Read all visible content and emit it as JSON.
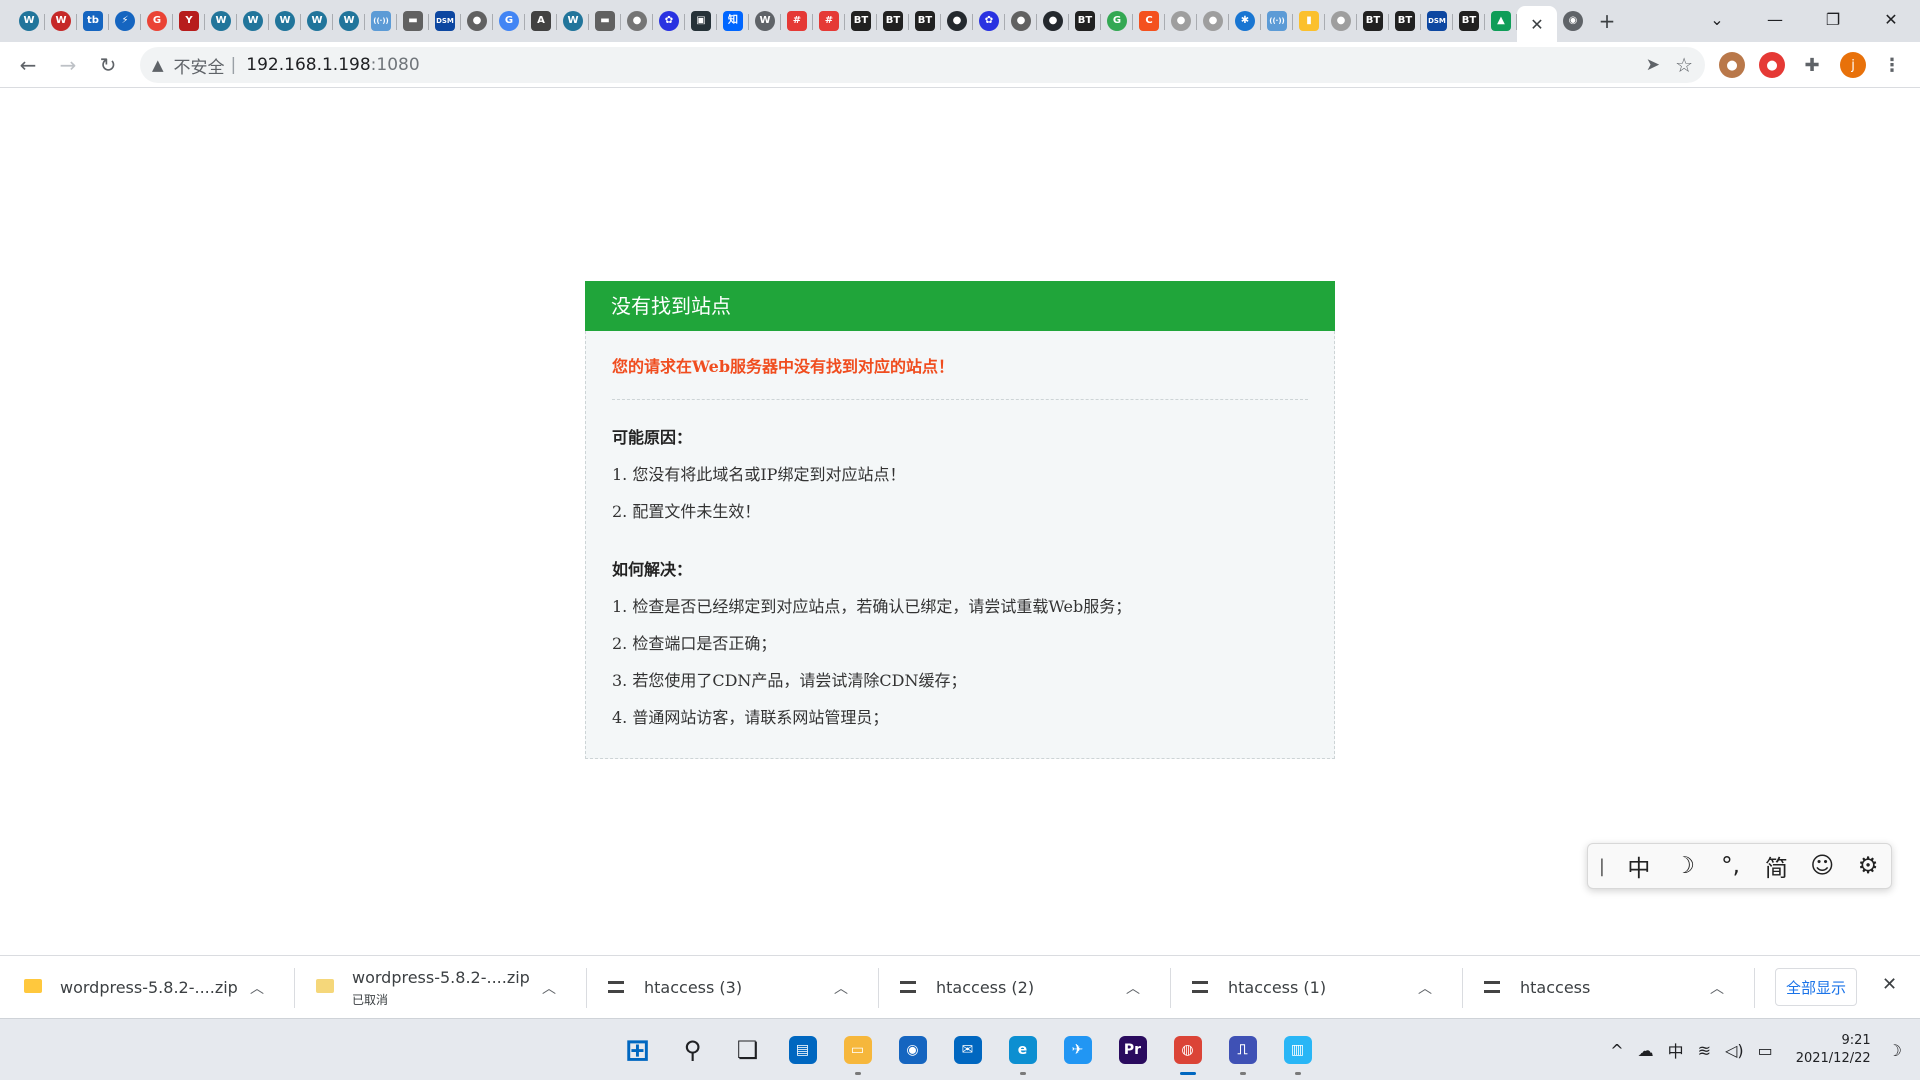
{
  "browser": {
    "tab_favicons": [
      {
        "icon": "wordpress-icon",
        "glyph": "W",
        "color": "#21759b",
        "round": true
      },
      {
        "icon": "wordpress-red-icon",
        "glyph": "W",
        "color": "#c62828",
        "round": true
      },
      {
        "icon": "tb-icon",
        "glyph": "tb",
        "color": "#1565c0",
        "round": false
      },
      {
        "icon": "lightning-icon",
        "glyph": "⚡",
        "color": "#1565c0",
        "round": true
      },
      {
        "icon": "google-icon",
        "glyph": "G",
        "color": "#ea4335",
        "round": true
      },
      {
        "icon": "bookmark-red-icon",
        "glyph": "Y",
        "color": "#b71c1c",
        "round": false
      },
      {
        "icon": "wordpress-icon",
        "glyph": "W",
        "color": "#21759b",
        "round": true
      },
      {
        "icon": "wordpress-icon",
        "glyph": "W",
        "color": "#21759b",
        "round": true
      },
      {
        "icon": "wordpress-icon",
        "glyph": "W",
        "color": "#21759b",
        "round": true
      },
      {
        "icon": "wordpress-icon",
        "glyph": "W",
        "color": "#21759b",
        "round": true
      },
      {
        "icon": "wordpress-icon",
        "glyph": "W",
        "color": "#21759b",
        "round": true
      },
      {
        "icon": "wireless-icon",
        "glyph": "((·))",
        "color": "#5c9bd6",
        "round": false
      },
      {
        "icon": "router-icon",
        "glyph": "▬",
        "color": "#616161",
        "round": false
      },
      {
        "icon": "dsm-icon",
        "glyph": "DSM",
        "color": "#0d47a1",
        "round": false
      },
      {
        "icon": "globe-icon",
        "glyph": "●",
        "color": "#616161",
        "round": true
      },
      {
        "icon": "google-icon",
        "glyph": "G",
        "color": "#4285f4",
        "round": true
      },
      {
        "icon": "finder-icon",
        "glyph": "A",
        "color": "#424242",
        "round": false
      },
      {
        "icon": "wordpress-icon",
        "glyph": "W",
        "color": "#21759b",
        "round": true
      },
      {
        "icon": "router-icon",
        "glyph": "▬",
        "color": "#616161",
        "round": false
      },
      {
        "icon": "globe-icon",
        "glyph": "●",
        "color": "#757575",
        "round": true
      },
      {
        "icon": "baidu-icon",
        "glyph": "✿",
        "color": "#2932e1",
        "round": true
      },
      {
        "icon": "image-icon",
        "glyph": "▣",
        "color": "#263238",
        "round": false
      },
      {
        "icon": "zhihu-icon",
        "glyph": "知",
        "color": "#0066ff",
        "round": false
      },
      {
        "icon": "wordpress-icon",
        "glyph": "W",
        "color": "#5f6368",
        "round": true
      },
      {
        "icon": "hash-red-icon",
        "glyph": "#",
        "color": "#e53935",
        "round": false
      },
      {
        "icon": "hash-red-icon",
        "glyph": "#",
        "color": "#e53935",
        "round": false
      },
      {
        "icon": "bt-icon",
        "glyph": "BT",
        "color": "#212121",
        "round": false
      },
      {
        "icon": "bt-icon",
        "glyph": "BT",
        "color": "#212121",
        "round": false
      },
      {
        "icon": "bt-icon",
        "glyph": "BT",
        "color": "#212121",
        "round": false
      },
      {
        "icon": "github-icon",
        "glyph": "●",
        "color": "#24292e",
        "round": true
      },
      {
        "icon": "baidu-icon",
        "glyph": "✿",
        "color": "#2932e1",
        "round": true
      },
      {
        "icon": "globe-icon",
        "glyph": "●",
        "color": "#616161",
        "round": true
      },
      {
        "icon": "github-icon",
        "glyph": "●",
        "color": "#24292e",
        "round": true
      },
      {
        "icon": "bt-icon",
        "glyph": "BT",
        "color": "#212121",
        "round": false
      },
      {
        "icon": "google-icon",
        "glyph": "G",
        "color": "#34a853",
        "round": true
      },
      {
        "icon": "c-red-icon",
        "glyph": "C",
        "color": "#f4511e",
        "round": false
      },
      {
        "icon": "globe-icon",
        "glyph": "●",
        "color": "#9e9e9e",
        "round": true
      },
      {
        "icon": "globe-icon",
        "glyph": "●",
        "color": "#9e9e9e",
        "round": true
      },
      {
        "icon": "gear-blue-icon",
        "glyph": "✱",
        "color": "#1976d2",
        "round": true
      },
      {
        "icon": "wireless-icon",
        "glyph": "((·))",
        "color": "#5c9bd6",
        "round": false
      },
      {
        "icon": "chart-icon",
        "glyph": "▮",
        "color": "#fbc02d",
        "round": false
      },
      {
        "icon": "globe-icon",
        "glyph": "●",
        "color": "#9e9e9e",
        "round": true
      },
      {
        "icon": "bt-icon",
        "glyph": "BT",
        "color": "#212121",
        "round": false
      },
      {
        "icon": "bt-icon",
        "glyph": "BT",
        "color": "#212121",
        "round": false
      },
      {
        "icon": "dsm-icon",
        "glyph": "DSM",
        "color": "#0d47a1",
        "round": false
      },
      {
        "icon": "bt-icon",
        "glyph": "BT",
        "color": "#212121",
        "round": false
      },
      {
        "icon": "drive-icon",
        "glyph": "▲",
        "color": "#0f9d58",
        "round": false
      }
    ],
    "active_tab_close": "✕",
    "tail_favicon": {
      "icon": "chrome-gray-icon",
      "glyph": "◉"
    },
    "new_tab": "+",
    "tab_search": "⌄",
    "window_controls": {
      "minimize": "—",
      "restore": "❐",
      "close": "✕"
    },
    "address": {
      "insecure_label": "不安全",
      "separator": "|",
      "host": "192.168.1.198",
      "port": ":1080"
    },
    "profile_initial": "j"
  },
  "page": {
    "title": "没有找到站点",
    "error_message": "您的请求在Web服务器中没有找到对应的站点！",
    "causes_heading": "可能原因：",
    "causes": [
      "1.  您没有将此域名或IP绑定到对应站点！",
      "2.  配置文件未生效！"
    ],
    "solutions_heading": "如何解决：",
    "solutions": [
      "1.  检查是否已经绑定到对应站点，若确认已绑定，请尝试重载Web服务；",
      "2.  检查端口是否正确；",
      "3.  若您使用了CDN产品，请尝试清除CDN缓存；",
      "4.  普通网站访客，请联系网站管理员；"
    ]
  },
  "ime_toolbar": {
    "grip": "|",
    "mode": "中",
    "moon": "☽",
    "punct": "°,",
    "script": "简",
    "emoji": "☺",
    "settings": "⚙"
  },
  "downloads": {
    "items": [
      {
        "name": "wordpress-5.8.2-....zip",
        "status": ""
      },
      {
        "name": "wordpress-5.8.2-....zip",
        "status": "已取消"
      },
      {
        "name": "htaccess (3)",
        "status": ""
      },
      {
        "name": "htaccess (2)",
        "status": ""
      },
      {
        "name": "htaccess (1)",
        "status": ""
      },
      {
        "name": "htaccess",
        "status": ""
      }
    ],
    "show_all": "全部显示",
    "close": "✕"
  },
  "taskbar": {
    "apps": [
      {
        "icon": "windows-start-icon",
        "glyph": "⊞",
        "color": "#0067c0"
      },
      {
        "icon": "search-icon",
        "glyph": "⚲",
        "color": "#202124"
      },
      {
        "icon": "task-view-icon",
        "glyph": "❏",
        "color": "#202124"
      },
      {
        "icon": "widgets-icon",
        "glyph": "▤",
        "color": "#0067c0"
      },
      {
        "icon": "file-explorer-icon",
        "glyph": "▭",
        "color": "#f6b73c"
      },
      {
        "icon": "app-circle-icon",
        "glyph": "◉",
        "color": "#1565c0"
      },
      {
        "icon": "mail-icon",
        "glyph": "✉",
        "color": "#0067c0"
      },
      {
        "icon": "edge-icon",
        "glyph": "e",
        "color": "#0c8fd1"
      },
      {
        "icon": "bird-icon",
        "glyph": "✈",
        "color": "#2196f3"
      },
      {
        "icon": "premiere-icon",
        "glyph": "Pr",
        "color": "#2a0b5e"
      },
      {
        "icon": "chrome-icon",
        "glyph": "◍",
        "color": "#db4437"
      },
      {
        "icon": "network-app-icon",
        "glyph": "⎍",
        "color": "#3f51b5"
      },
      {
        "icon": "notepad-icon",
        "glyph": "▥",
        "color": "#29b6f6"
      }
    ],
    "tray": {
      "chevron": "^",
      "cloud": "☁",
      "ime": "中",
      "wifi": "≋",
      "volume": "◁)",
      "battery": "▭",
      "time": "9:21",
      "date": "2021/12/22",
      "moon": "☽"
    }
  }
}
